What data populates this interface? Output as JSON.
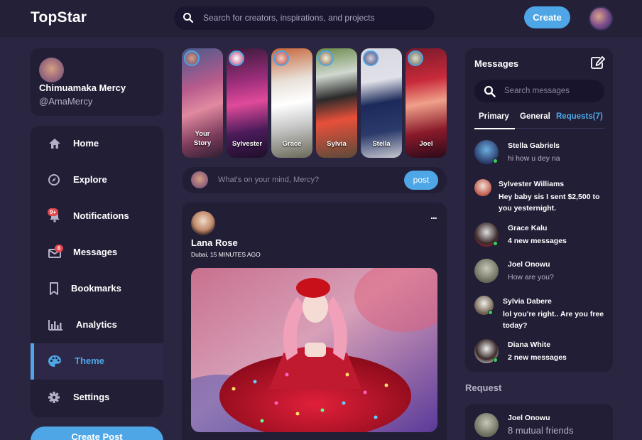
{
  "app": {
    "name": "TopStar"
  },
  "nav": {
    "search_placeholder": "Search for creators, inspirations, and projects",
    "create_label": "Create"
  },
  "profile": {
    "name": "Chimuamaka Mercy",
    "handle": "@AmaMercy"
  },
  "menu": {
    "items": [
      {
        "label": "Home",
        "icon": "home-icon"
      },
      {
        "label": "Explore",
        "icon": "compass-icon"
      },
      {
        "label": "Notifications",
        "icon": "bell-icon",
        "badge": "9+"
      },
      {
        "label": "Messages",
        "icon": "envelope-icon",
        "badge": "6"
      },
      {
        "label": "Bookmarks",
        "icon": "bookmark-icon"
      },
      {
        "label": "Analytics",
        "icon": "chart-icon"
      },
      {
        "label": "Theme",
        "icon": "palette-icon",
        "active": true
      },
      {
        "label": "Settings",
        "icon": "gear-icon"
      }
    ],
    "create_post_label": "Create Post"
  },
  "stories": [
    {
      "name": "Your Story",
      "line1": "Your",
      "line2": "Story"
    },
    {
      "name": "Sylvester"
    },
    {
      "name": "Grace"
    },
    {
      "name": "Sylvia"
    },
    {
      "name": "Stella"
    },
    {
      "name": "Joel"
    }
  ],
  "compose": {
    "placeholder": "What's on your mind, Mercy?",
    "post_label": "post"
  },
  "feed": {
    "author": "Lana Rose",
    "location": "Dubai, 15 MINUTES AGO",
    "more": "..."
  },
  "messages": {
    "title": "Messages",
    "search_placeholder": "Search messages",
    "tabs": {
      "primary": "Primary",
      "general": "General",
      "requests": "Requests(7)"
    },
    "items": [
      {
        "name": "Stella Gabriels",
        "text": "hi how u dey na",
        "online": true,
        "unread": false
      },
      {
        "name": "Sylvester Williams",
        "text": "Hey baby sis I sent $2,500 to you yesternight.",
        "online": false,
        "unread": true
      },
      {
        "name": "Grace Kalu",
        "text": "4 new messages",
        "online": true,
        "unread": true
      },
      {
        "name": "Joel Onowu",
        "text": "How are you?",
        "online": false,
        "unread": false
      },
      {
        "name": "Sylvia Dabere",
        "text": "lol you're right.. Are you free today?",
        "online": true,
        "unread": true
      },
      {
        "name": "Diana White",
        "text": "2 new messages",
        "online": true,
        "unread": true
      }
    ]
  },
  "requests": {
    "title": "Request",
    "items": [
      {
        "name": "Joel Onowu",
        "text": "8 mutual friends"
      }
    ]
  },
  "colors": {
    "accent": "#4ea6e6",
    "background": "#2a2540",
    "card": "#221e36",
    "online": "#39d353",
    "badge": "#e5484d"
  }
}
